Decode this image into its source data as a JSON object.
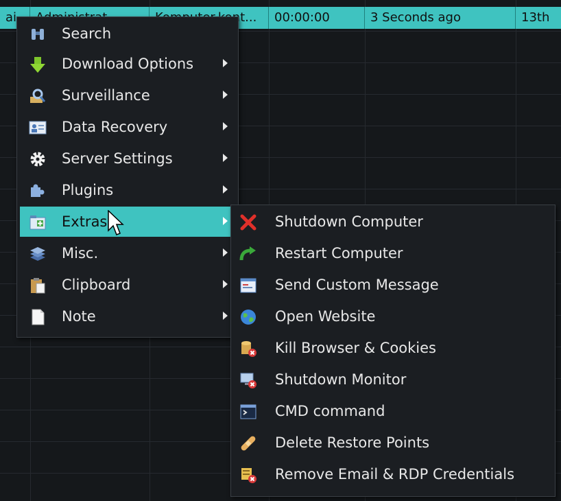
{
  "table": {
    "selected_row": {
      "cells": [
        "ai..",
        "Administrat...",
        "Komputer.kont...",
        "00:00:00",
        "3 Seconds ago",
        "13th"
      ]
    }
  },
  "main_menu": {
    "items": [
      {
        "label": "Search",
        "icon": "binoculars-icon",
        "submenu": false
      },
      {
        "label": "Download Options",
        "icon": "download-arrow-icon",
        "submenu": true
      },
      {
        "label": "Surveillance",
        "icon": "magnifier-icon",
        "submenu": true
      },
      {
        "label": "Data Recovery",
        "icon": "id-card-icon",
        "submenu": true
      },
      {
        "label": "Server Settings",
        "icon": "gear-icon",
        "submenu": true
      },
      {
        "label": "Plugins",
        "icon": "puzzle-icon",
        "submenu": true
      },
      {
        "label": "Extras",
        "icon": "folder-plus-icon",
        "submenu": true,
        "highlighted": true
      },
      {
        "label": "Misc.",
        "icon": "layers-icon",
        "submenu": true
      },
      {
        "label": "Clipboard",
        "icon": "clipboard-icon",
        "submenu": true
      },
      {
        "label": "Note",
        "icon": "note-icon",
        "submenu": true
      }
    ]
  },
  "extras_menu": {
    "items": [
      {
        "label": "Shutdown Computer",
        "icon": "red-x-icon"
      },
      {
        "label": "Restart Computer",
        "icon": "restart-arrow-icon"
      },
      {
        "label": "Send Custom Message",
        "icon": "message-window-icon"
      },
      {
        "label": "Open Website",
        "icon": "globe-icon"
      },
      {
        "label": "Kill Browser & Cookies",
        "icon": "database-delete-icon"
      },
      {
        "label": "Shutdown Monitor",
        "icon": "monitor-delete-icon"
      },
      {
        "label": "CMD command",
        "icon": "console-icon"
      },
      {
        "label": "Delete Restore Points",
        "icon": "bandage-icon"
      },
      {
        "label": "Remove Email & RDP Credentials",
        "icon": "credentials-delete-icon"
      }
    ]
  },
  "colors": {
    "highlight": "#3fc3c0",
    "menu_bg": "#1b1e22",
    "text": "#e8e8e8"
  }
}
